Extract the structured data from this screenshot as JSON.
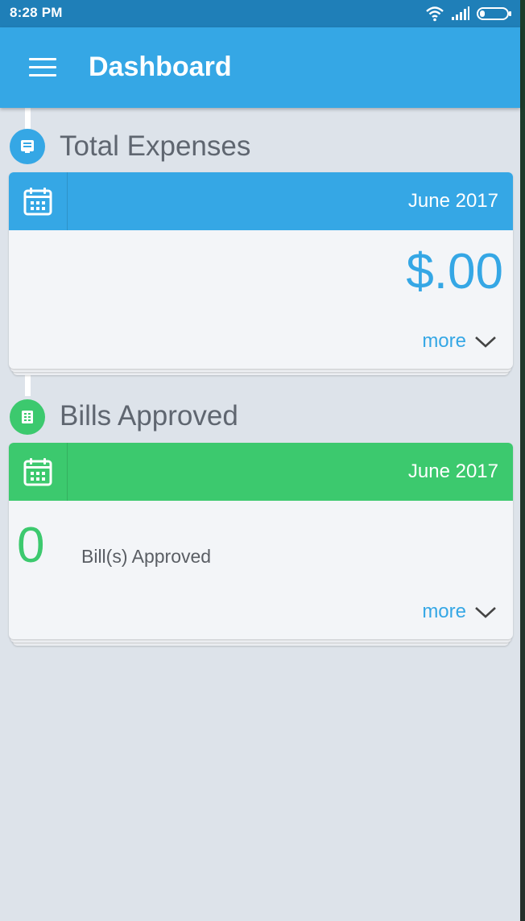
{
  "status_bar": {
    "time": "8:28 PM",
    "icons": [
      "wifi-icon",
      "signal-icon",
      "battery-icon"
    ]
  },
  "app_bar": {
    "title": "Dashboard",
    "menu_icon": "hamburger-menu-icon"
  },
  "colors": {
    "primary_blue": "#35a7e5",
    "status_blue": "#1f7fb8",
    "green": "#3cc96e",
    "background": "#dde3ea",
    "card": "#f3f5f8"
  },
  "sections": {
    "expenses": {
      "title": "Total Expenses",
      "icon": "receipt-icon",
      "period": "June 2017",
      "amount": "$.00",
      "more_label": "more"
    },
    "bills": {
      "title": "Bills Approved",
      "icon": "document-icon",
      "period": "June 2017",
      "count": "0",
      "count_label": "Bill(s) Approved",
      "more_label": "more"
    }
  }
}
